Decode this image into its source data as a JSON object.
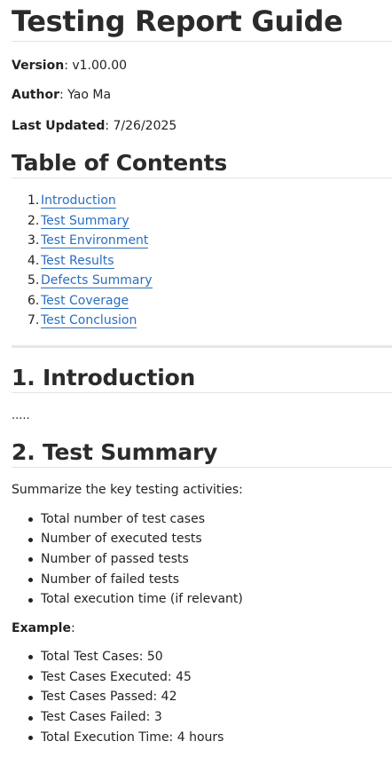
{
  "title": "Testing Report Guide",
  "meta": [
    {
      "label": "Version",
      "value": ": v1.00.00"
    },
    {
      "label": "Author",
      "value": ": Yao Ma"
    },
    {
      "label": "Last Updated",
      "value": ": 7/26/2025"
    }
  ],
  "toc": {
    "heading": "Table of Contents",
    "items": [
      {
        "num": "1.",
        "label": "Introduction"
      },
      {
        "num": "2.",
        "label": "Test Summary"
      },
      {
        "num": "3.",
        "label": "Test Environment"
      },
      {
        "num": "4.",
        "label": "Test Results"
      },
      {
        "num": "5.",
        "label": "Defects Summary"
      },
      {
        "num": "6.",
        "label": "Test Coverage"
      },
      {
        "num": "7.",
        "label": "Test Conclusion"
      }
    ]
  },
  "introduction": {
    "heading": "1. Introduction",
    "body": "....."
  },
  "summary": {
    "heading": "2. Test Summary",
    "intro": "Summarize the key testing activities:",
    "items": [
      "Total number of test cases",
      "Number of executed tests",
      "Number of passed tests",
      "Number of failed tests",
      "Total execution time (if relevant)"
    ],
    "example_label": "Example",
    "example_suffix": ":",
    "example_items": [
      "Total Test Cases: 50",
      "Test Cases Executed: 45",
      "Test Cases Passed: 42",
      "Test Cases Failed: 3",
      "Total Execution Time: 4 hours"
    ]
  },
  "colors": {
    "link": "#2a6fc0",
    "text": "#222222",
    "rule": "#e3e3e3"
  }
}
